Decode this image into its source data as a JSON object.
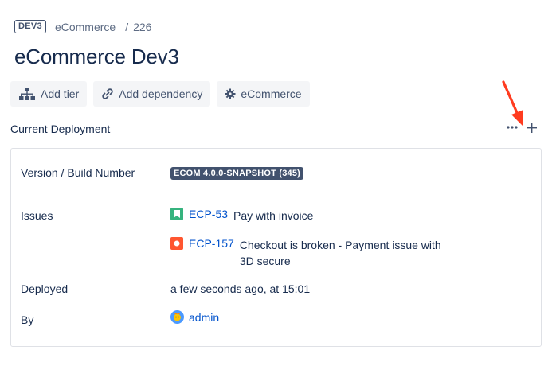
{
  "breadcrumb": {
    "env_badge": "DEV3",
    "project": "eCommerce",
    "separator": "/",
    "id": "226"
  },
  "page_title": "eCommerce Dev3",
  "toolbar": {
    "add_tier": "Add tier",
    "add_dependency": "Add dependency",
    "ecommerce": "eCommerce"
  },
  "section": {
    "title": "Current Deployment"
  },
  "deployment": {
    "version_label": "Version / Build Number",
    "version_value": "ECOM 4.0.0-SNAPSHOT (345)",
    "issues_label": "Issues",
    "issues": [
      {
        "key": "ECP-53",
        "summary": "Pay with invoice",
        "type_icon": "story-icon",
        "type_color": "#36b37e"
      },
      {
        "key": "ECP-157",
        "summary": "Checkout is broken - Payment issue with 3D secure",
        "type_icon": "bug-icon",
        "type_color": "#ff5630"
      }
    ],
    "deployed_label": "Deployed",
    "deployed_value": "a few seconds ago, at 15:01",
    "by_label": "By",
    "by_value": "admin"
  },
  "colors": {
    "accent_arrow": "#ff3b1f",
    "link": "#0052cc",
    "lozenge": "#42526e"
  }
}
